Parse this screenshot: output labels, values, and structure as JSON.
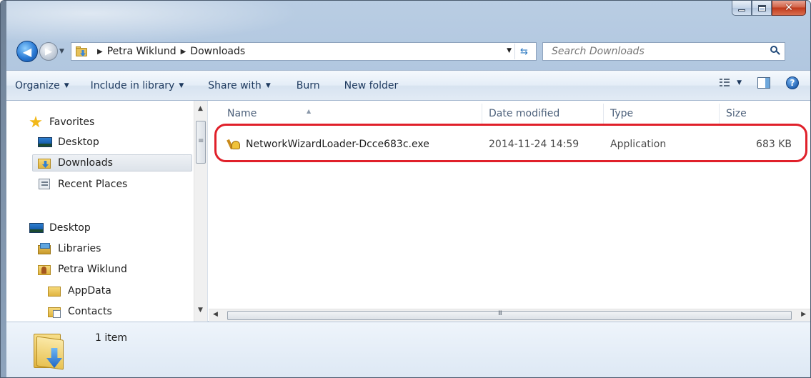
{
  "breadcrumbs": [
    "Petra Wiklund",
    "Downloads"
  ],
  "search": {
    "placeholder": "Search Downloads"
  },
  "toolbar": {
    "organize_label": "Organize",
    "include_label": "Include in library",
    "share_label": "Share with",
    "burn_label": "Burn",
    "newfolder_label": "New folder"
  },
  "nav": {
    "favorites_label": "Favorites",
    "items": [
      {
        "label": "Desktop",
        "icon": "desktop-icon"
      },
      {
        "label": "Downloads",
        "icon": "downloads-folder-icon"
      },
      {
        "label": "Recent Places",
        "icon": "recent-places-icon"
      }
    ],
    "tree": [
      {
        "label": "Desktop",
        "icon": "desktop-icon"
      },
      {
        "label": "Libraries",
        "icon": "libraries-icon"
      },
      {
        "label": "Petra Wiklund",
        "icon": "user-folder-icon"
      },
      {
        "label": "AppData",
        "icon": "folder-icon"
      },
      {
        "label": "Contacts",
        "icon": "contacts-folder-icon"
      }
    ]
  },
  "columns": [
    "Name",
    "Date modified",
    "Type",
    "Size"
  ],
  "files": [
    {
      "name": "NetworkWizardLoader-Dcce683c.exe",
      "date": "2014-11-24 14:59",
      "type": "Application",
      "size": "683 KB"
    }
  ],
  "status": {
    "item_count": "1 item"
  },
  "colors": {
    "highlight": "#e0202a",
    "accent": "#2a7ad5"
  }
}
